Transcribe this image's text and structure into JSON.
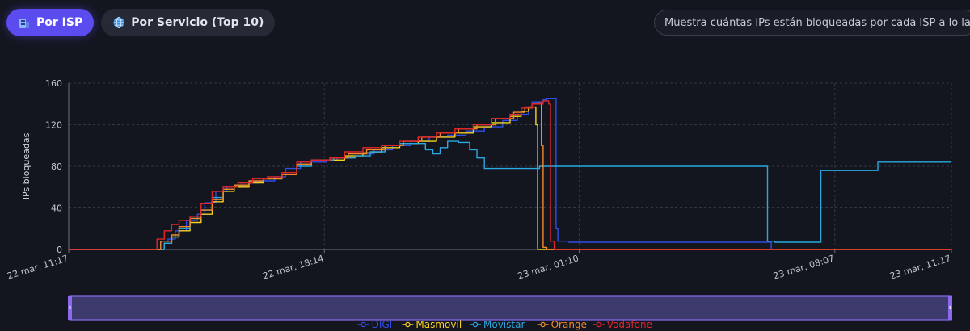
{
  "tabs": [
    {
      "label": "Por ISP",
      "icon": "building-icon",
      "active": true
    },
    {
      "label": "Por Servicio (Top 10)",
      "icon": "globe-icon",
      "active": false
    }
  ],
  "description": "Muestra cuántas IPs están bloqueadas por cada ISP a lo largo del tiempo",
  "chart_data": {
    "type": "line",
    "ylabel": "IPs bloqueadas",
    "ylim": [
      0,
      160
    ],
    "yticks": [
      0,
      40,
      80,
      120,
      160
    ],
    "xlim": [
      0,
      24
    ],
    "xticks": [
      {
        "x": 0,
        "label": "22 mar, 11:17"
      },
      {
        "x": 6.95,
        "label": "22 mar, 18:14"
      },
      {
        "x": 13.88,
        "label": "23 mar, 01:10"
      },
      {
        "x": 20.83,
        "label": "23 mar, 08:07"
      },
      {
        "x": 24,
        "label": "23 mar, 11:17"
      }
    ],
    "x_axis_note": "hours since 22 mar, 11:17",
    "grid": true,
    "legend_position": "bottom",
    "series": [
      {
        "name": "DIGI",
        "color": "#2f4de6",
        "points": [
          [
            0,
            0
          ],
          [
            2.4,
            0
          ],
          [
            2.5,
            8
          ],
          [
            2.7,
            10
          ],
          [
            2.9,
            18
          ],
          [
            3.2,
            28
          ],
          [
            3.5,
            34
          ],
          [
            3.7,
            45
          ],
          [
            4.0,
            56
          ],
          [
            4.3,
            60
          ],
          [
            4.7,
            64
          ],
          [
            5.2,
            66
          ],
          [
            5.6,
            70
          ],
          [
            5.9,
            78
          ],
          [
            6.3,
            84
          ],
          [
            7.0,
            86
          ],
          [
            7.3,
            88
          ],
          [
            7.7,
            92
          ],
          [
            8.3,
            96
          ],
          [
            8.8,
            100
          ],
          [
            9.3,
            104
          ],
          [
            9.8,
            108
          ],
          [
            10.3,
            110
          ],
          [
            10.8,
            114
          ],
          [
            11.3,
            118
          ],
          [
            11.8,
            124
          ],
          [
            12.2,
            130
          ],
          [
            12.5,
            136
          ],
          [
            12.6,
            142
          ],
          [
            12.9,
            144
          ],
          [
            13.0,
            145
          ],
          [
            13.15,
            145
          ],
          [
            13.25,
            20
          ],
          [
            13.3,
            8
          ],
          [
            13.6,
            7
          ],
          [
            19.0,
            7
          ],
          [
            19.1,
            0
          ],
          [
            24,
            0
          ]
        ]
      },
      {
        "name": "Masmovil",
        "color": "#f5d21f",
        "points": [
          [
            0,
            0
          ],
          [
            2.5,
            0
          ],
          [
            2.6,
            6
          ],
          [
            2.8,
            12
          ],
          [
            3.0,
            18
          ],
          [
            3.3,
            26
          ],
          [
            3.6,
            34
          ],
          [
            3.9,
            46
          ],
          [
            4.2,
            56
          ],
          [
            4.5,
            60
          ],
          [
            4.9,
            64
          ],
          [
            5.3,
            68
          ],
          [
            5.8,
            72
          ],
          [
            6.2,
            82
          ],
          [
            6.6,
            86
          ],
          [
            7.1,
            86
          ],
          [
            7.5,
            90
          ],
          [
            8.0,
            93
          ],
          [
            8.5,
            98
          ],
          [
            9.0,
            102
          ],
          [
            9.5,
            104
          ],
          [
            10.0,
            108
          ],
          [
            10.5,
            112
          ],
          [
            11.0,
            118
          ],
          [
            11.5,
            122
          ],
          [
            12.0,
            128
          ],
          [
            12.3,
            133
          ],
          [
            12.5,
            137
          ],
          [
            12.65,
            137
          ],
          [
            12.7,
            120
          ],
          [
            12.75,
            0
          ],
          [
            24,
            0
          ]
        ]
      },
      {
        "name": "Movistar",
        "color": "#2aa8e0",
        "points": [
          [
            0,
            0
          ],
          [
            2.5,
            0
          ],
          [
            2.6,
            6
          ],
          [
            2.8,
            12
          ],
          [
            3.0,
            20
          ],
          [
            3.3,
            30
          ],
          [
            3.6,
            38
          ],
          [
            3.9,
            50
          ],
          [
            4.2,
            58
          ],
          [
            4.5,
            62
          ],
          [
            4.9,
            65
          ],
          [
            5.3,
            68
          ],
          [
            5.8,
            72
          ],
          [
            6.2,
            80
          ],
          [
            6.6,
            86
          ],
          [
            7.2,
            88
          ],
          [
            7.8,
            90
          ],
          [
            8.2,
            94
          ],
          [
            8.6,
            100
          ],
          [
            9.0,
            102
          ],
          [
            9.5,
            102
          ],
          [
            9.7,
            96
          ],
          [
            9.9,
            92
          ],
          [
            10.1,
            98
          ],
          [
            10.3,
            104
          ],
          [
            10.6,
            103
          ],
          [
            10.9,
            96
          ],
          [
            11.1,
            88
          ],
          [
            11.3,
            78
          ],
          [
            11.7,
            78
          ],
          [
            12.7,
            78
          ],
          [
            12.8,
            80
          ],
          [
            18.9,
            80
          ],
          [
            19.0,
            8
          ],
          [
            19.2,
            7
          ],
          [
            20.4,
            7
          ],
          [
            20.45,
            76
          ],
          [
            21.9,
            76
          ],
          [
            22.0,
            84
          ],
          [
            24,
            84
          ]
        ]
      },
      {
        "name": "Orange",
        "color": "#f28a2a",
        "points": [
          [
            0,
            0
          ],
          [
            2.4,
            0
          ],
          [
            2.5,
            8
          ],
          [
            2.8,
            14
          ],
          [
            3.0,
            22
          ],
          [
            3.3,
            30
          ],
          [
            3.6,
            38
          ],
          [
            3.9,
            48
          ],
          [
            4.2,
            58
          ],
          [
            4.5,
            62
          ],
          [
            4.9,
            66
          ],
          [
            5.3,
            68
          ],
          [
            5.8,
            72
          ],
          [
            6.2,
            82
          ],
          [
            6.6,
            86
          ],
          [
            7.1,
            88
          ],
          [
            7.6,
            92
          ],
          [
            8.1,
            96
          ],
          [
            8.6,
            100
          ],
          [
            9.1,
            104
          ],
          [
            9.6,
            108
          ],
          [
            10.1,
            112
          ],
          [
            10.6,
            116
          ],
          [
            11.1,
            120
          ],
          [
            11.6,
            126
          ],
          [
            12.1,
            132
          ],
          [
            12.4,
            137
          ],
          [
            12.6,
            140
          ],
          [
            12.75,
            141
          ],
          [
            12.85,
            100
          ],
          [
            12.9,
            2
          ],
          [
            13.0,
            0
          ],
          [
            24,
            0
          ]
        ]
      },
      {
        "name": "Vodafone",
        "color": "#e0262a",
        "points": [
          [
            0,
            0
          ],
          [
            2.3,
            0
          ],
          [
            2.4,
            10
          ],
          [
            2.6,
            18
          ],
          [
            2.8,
            24
          ],
          [
            3.0,
            28
          ],
          [
            3.3,
            32
          ],
          [
            3.6,
            44
          ],
          [
            3.9,
            56
          ],
          [
            4.2,
            60
          ],
          [
            4.6,
            64
          ],
          [
            5.0,
            68
          ],
          [
            5.4,
            70
          ],
          [
            5.8,
            74
          ],
          [
            6.2,
            84
          ],
          [
            6.6,
            86
          ],
          [
            7.1,
            88
          ],
          [
            7.5,
            94
          ],
          [
            8.0,
            98
          ],
          [
            8.5,
            100
          ],
          [
            9.0,
            104
          ],
          [
            9.5,
            108
          ],
          [
            10.0,
            112
          ],
          [
            10.5,
            116
          ],
          [
            11.0,
            120
          ],
          [
            11.5,
            126
          ],
          [
            12.0,
            130
          ],
          [
            12.3,
            136
          ],
          [
            12.6,
            140
          ],
          [
            12.9,
            143
          ],
          [
            13.0,
            143
          ],
          [
            13.05,
            140
          ],
          [
            13.1,
            8
          ],
          [
            13.2,
            0
          ],
          [
            24,
            0
          ]
        ]
      }
    ]
  }
}
